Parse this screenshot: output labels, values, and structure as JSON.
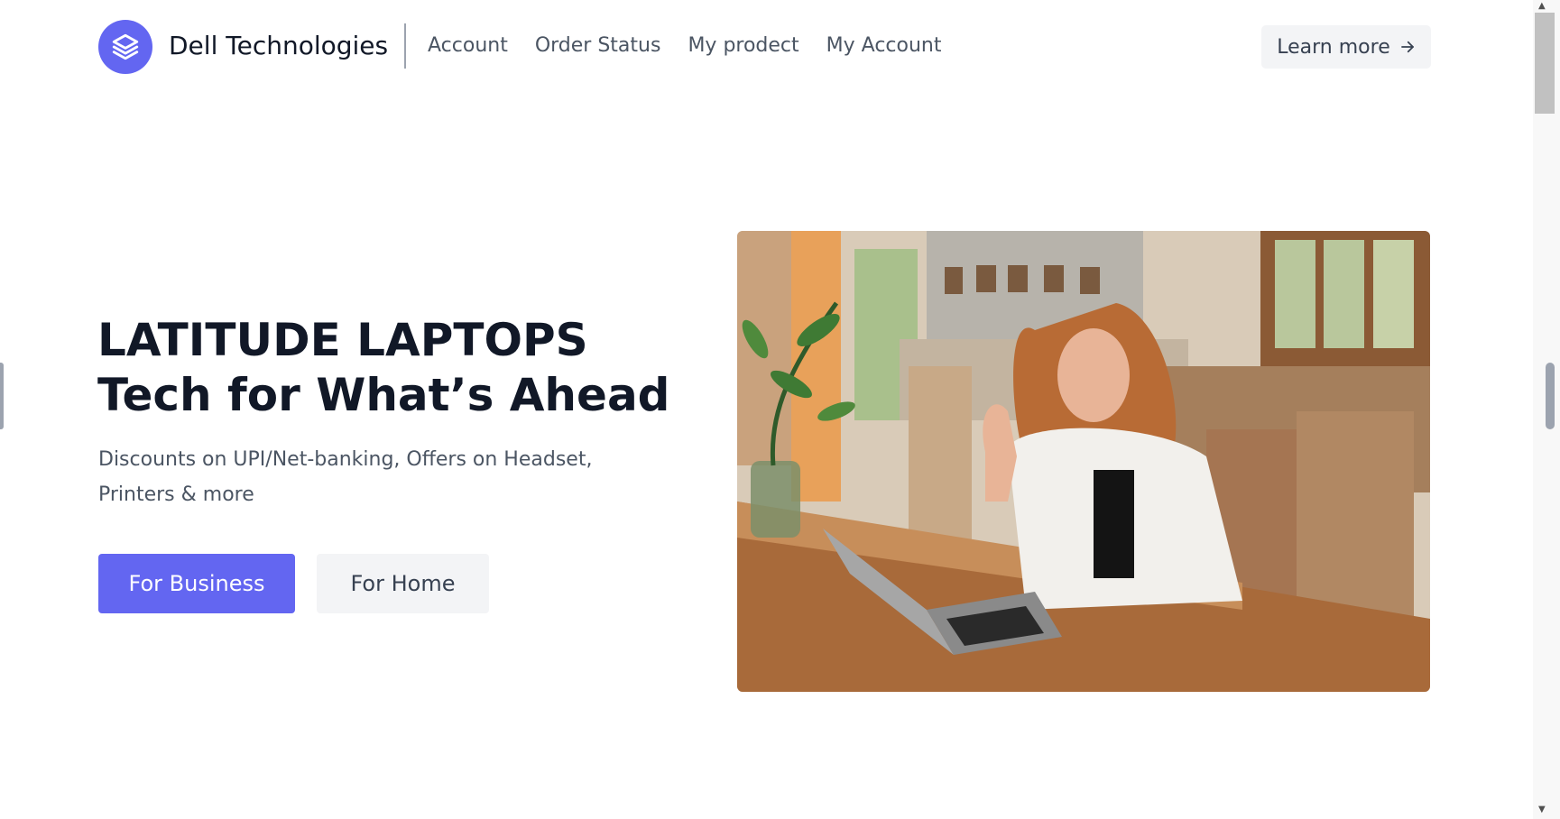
{
  "header": {
    "brand": "Dell Technologies",
    "logo_icon": "layers-icon",
    "nav": [
      "Account",
      "Order Status",
      "My prodect",
      "My Account"
    ],
    "learn_more": "Learn more",
    "learn_more_icon": "arrow-right-icon"
  },
  "hero": {
    "title_line1": "LATITUDE LAPTOPS",
    "title_line2": "Tech for What’s Ahead",
    "description": "Discounts on UPI/Net-banking, Offers on Headset, Printers & more",
    "primary_button": "For Business",
    "secondary_button": "For Home"
  },
  "colors": {
    "accent": "#6366f1",
    "button_gray": "#f3f4f6",
    "text_dark": "#111827",
    "text_muted": "#4b5563"
  }
}
